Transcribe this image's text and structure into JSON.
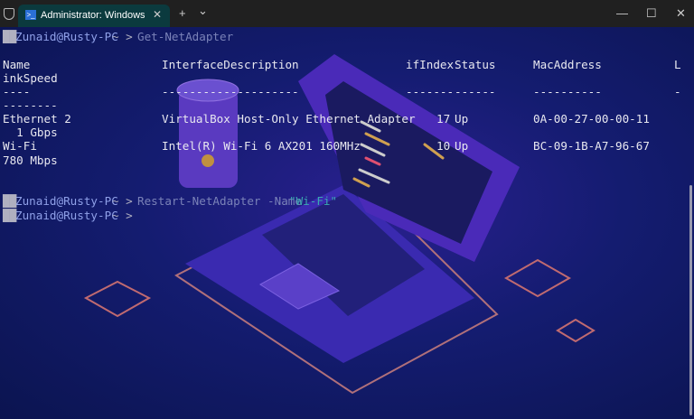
{
  "tab": {
    "title": "Administrator: Windows PowerShell",
    "new_tab": "+",
    "dropdown": "⌄",
    "close": "✕"
  },
  "window": {
    "minimize": "—",
    "maximize": "☐",
    "close": "✕"
  },
  "terminal": {
    "prompt_user": "Zunaid@Rusty-PC",
    "prompt_sep": "~ >",
    "cmd1": "Get-NetAdapter",
    "headers": [
      "Name",
      "InterfaceDescription",
      "ifIndex",
      "Status",
      "MacAddress",
      "L",
      "inkSpeed"
    ],
    "dashes": [
      "----",
      "--------------------",
      "-------",
      "------",
      "----------",
      "-",
      "--------"
    ],
    "rows": [
      {
        "name": "Ethernet 2",
        "desc": "VirtualBox Host-Only Ethernet Adapter",
        "ifindex": "17",
        "status": "Up",
        "mac": "0A-00-27-00-00-11",
        "speed": "  1 Gbps"
      },
      {
        "name": "Wi-Fi",
        "desc": "Intel(R) Wi-Fi 6 AX201 160MHz",
        "ifindex": "10",
        "status": "Up",
        "mac": "BC-09-1B-A7-96-67",
        "speed": "780 Mbps"
      }
    ],
    "cmd2": "Restart-NetAdapter -Name",
    "cmd2_arg": "\"Wi-Fi\""
  }
}
